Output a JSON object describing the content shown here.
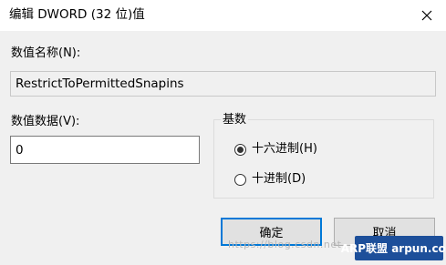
{
  "window": {
    "title": "编辑 DWORD (32 位)值",
    "close_icon": "close-icon"
  },
  "value_name": {
    "label": "数值名称(N):",
    "value": "RestrictToPermittedSnapins"
  },
  "value_data": {
    "label": "数值数据(V):",
    "value": "0"
  },
  "base": {
    "label": "基数",
    "options": [
      {
        "label": "十六进制(H)",
        "selected": true
      },
      {
        "label": "十进制(D)",
        "selected": false
      }
    ]
  },
  "buttons": {
    "ok": "确定",
    "cancel": "取消"
  },
  "watermark": {
    "url": "https://blog.csdn.net",
    "badge": "ARP联盟 arpun.com"
  }
}
